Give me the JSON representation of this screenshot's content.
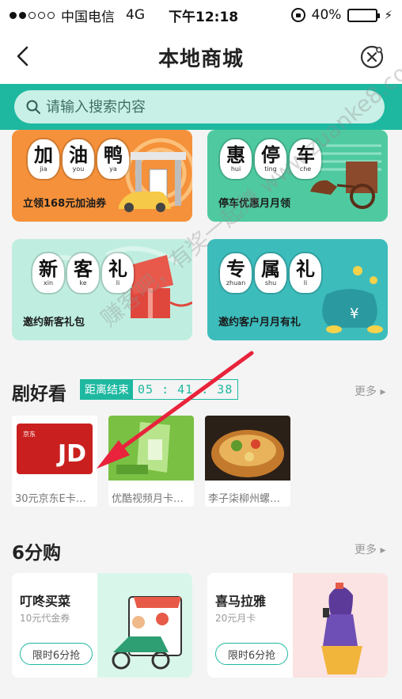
{
  "status_bar": {
    "carrier": "中国电信",
    "network": "4G",
    "time": "下午12:18",
    "battery": "40%",
    "battery_level": 0.4
  },
  "nav": {
    "title": "本地商城"
  },
  "search": {
    "placeholder": "请输入搜索内容"
  },
  "banners": [
    {
      "chars": [
        {
          "hz": "加",
          "py": "jia"
        },
        {
          "hz": "油",
          "py": "you"
        },
        {
          "hz": "鸭",
          "py": "ya"
        }
      ],
      "subtitle": "立领168元加油券",
      "bg": "#f5913a"
    },
    {
      "chars": [
        {
          "hz": "惠",
          "py": "hui"
        },
        {
          "hz": "停",
          "py": "ting"
        },
        {
          "hz": "车",
          "py": "che"
        }
      ],
      "subtitle": "停车优惠月月领",
      "bg": "#4fcaa0"
    },
    {
      "chars": [
        {
          "hz": "新",
          "py": "xin"
        },
        {
          "hz": "客",
          "py": "ke"
        },
        {
          "hz": "礼",
          "py": "li"
        }
      ],
      "subtitle": "邀约新客礼包",
      "bg": "#bfeee0"
    },
    {
      "chars": [
        {
          "hz": "专",
          "py": "zhuan"
        },
        {
          "hz": "属",
          "py": "shu"
        },
        {
          "hz": "礼",
          "py": "li"
        }
      ],
      "subtitle": "邀约客户月月有礼",
      "bg": "#3dbcbc"
    }
  ],
  "drama": {
    "title": "剧好看",
    "countdown_label": "距离结束",
    "countdown": "05 : 41 : 38",
    "more": "更多 ▸",
    "items": [
      {
        "caption": "30元京东E卡…",
        "thumb_text": "JD"
      },
      {
        "caption": "优酷视频月卡…"
      },
      {
        "caption": "李子柒柳州螺…"
      }
    ]
  },
  "six_buy": {
    "title": "6分购",
    "more": "更多 ▸",
    "items": [
      {
        "name": "叮咚买菜",
        "desc": "10元代金券",
        "button": "限时6分抢",
        "art_bg": "#d9f6ea"
      },
      {
        "name": "喜马拉雅",
        "desc": "20元月卡",
        "button": "限时6分抢",
        "art_bg": "#fbe3e3"
      }
    ]
  },
  "watermark": "赚客吧，有奖一起赚 www.zuanke8.com",
  "colors": {
    "accent": "#1eb8a0",
    "arrow": "#e8233b"
  }
}
